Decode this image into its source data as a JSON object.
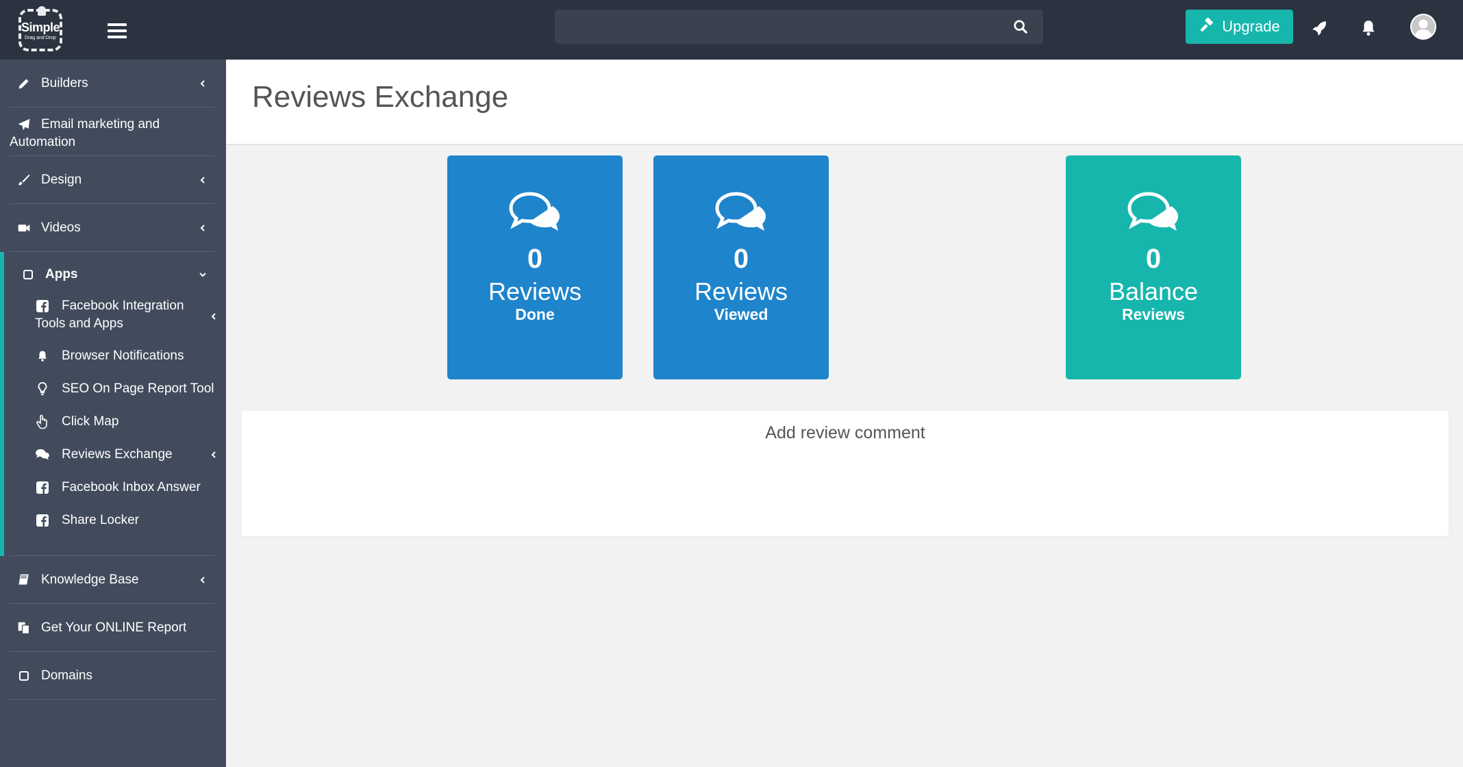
{
  "topbar": {
    "logo": {
      "line1": "Simple",
      "line2": "Drag and Drop"
    },
    "search": {
      "placeholder": "",
      "value": ""
    },
    "upgrade_label": "Upgrade"
  },
  "sidebar": {
    "items": [
      {
        "label": "Builders",
        "icon": "pencil-icon",
        "has_chevron": true
      },
      {
        "label": "Email marketing and",
        "label2": "Automation",
        "icon": "paper-plane-icon",
        "has_chevron": false
      },
      {
        "label": "Design",
        "icon": "paint-brush-icon",
        "has_chevron": true
      },
      {
        "label": "Videos",
        "icon": "video-camera-icon",
        "has_chevron": true
      },
      {
        "label": "Apps",
        "icon": "square-icon",
        "has_chevron": true,
        "expanded": true
      },
      {
        "label": "Knowledge Base",
        "icon": "book-icon",
        "has_chevron": true
      },
      {
        "label": "Get Your ONLINE Report",
        "icon": "copy-icon",
        "has_chevron": false
      },
      {
        "label": "Domains",
        "icon": "square-icon",
        "has_chevron": false
      }
    ],
    "apps_sub": [
      {
        "label": "Facebook Integration",
        "label2": "Tools and Apps",
        "icon": "facebook-square-icon",
        "has_chevron": true
      },
      {
        "label": "Browser Notifications",
        "icon": "bell-icon"
      },
      {
        "label": "SEO On Page Report Tool",
        "icon": "lightbulb-icon"
      },
      {
        "label": "Click Map",
        "icon": "hand-pointer-icon"
      },
      {
        "label": "Reviews Exchange",
        "icon": "comments-icon",
        "has_chevron": true
      },
      {
        "label": "Facebook Inbox Answer",
        "icon": "facebook-square-icon"
      },
      {
        "label": "Share Locker",
        "icon": "facebook-square-icon"
      }
    ]
  },
  "main": {
    "title": "Reviews Exchange",
    "cards": [
      {
        "count": "0",
        "label": "Reviews",
        "sub": "Done",
        "color": "#1e84cb",
        "icon": "comments-icon"
      },
      {
        "count": "0",
        "label": "Reviews",
        "sub": "Viewed",
        "color": "#1e84cb",
        "icon": "comments-icon"
      },
      {
        "count": "0",
        "label": "Balance",
        "sub": "Reviews",
        "color": "#16b6ad",
        "icon": "comments-icon"
      }
    ],
    "comment_panel_title": "Add review comment"
  },
  "colors": {
    "topbar": "#2b3341",
    "sidebar": "#414b5c",
    "accent": "#16b6ad",
    "card_blue": "#1e84cb"
  }
}
